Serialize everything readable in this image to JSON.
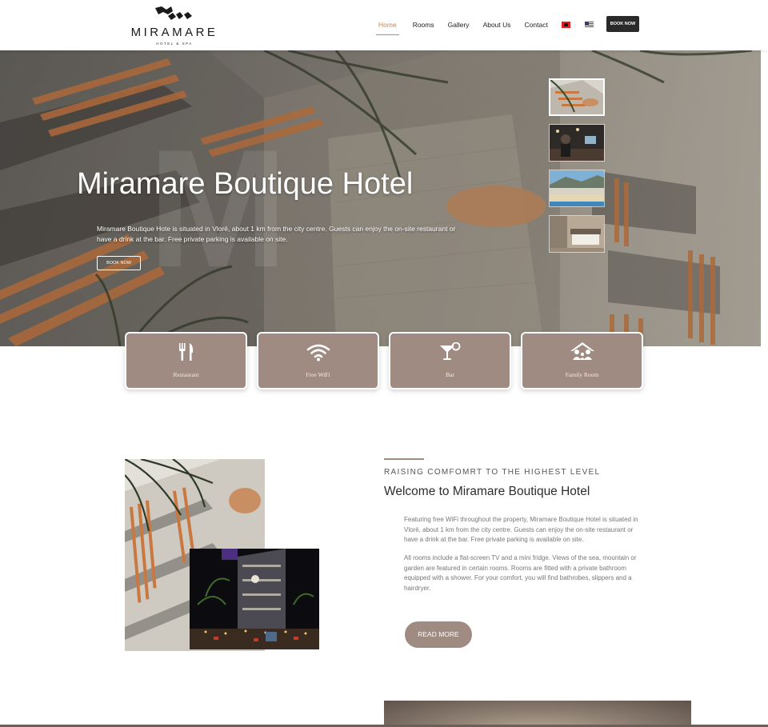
{
  "logo": {
    "name": "MIRAMARE",
    "tagline": "HOTEL & SPA"
  },
  "nav": {
    "items": [
      {
        "label": "Home",
        "active": true
      },
      {
        "label": "Rooms"
      },
      {
        "label": "Gallery"
      },
      {
        "label": "About Us"
      },
      {
        "label": "Contact"
      }
    ],
    "languages": [
      "albanian-flag-icon",
      "us-flag-icon"
    ],
    "book_label": "BOOK NOW"
  },
  "hero": {
    "title": "Miramare Boutique Hotel",
    "description": "Miramare Boutique Hote is situated in Vlorë, about 1 km from the city centre. Guests can enjoy the on-site restaurant or have a drink at the bar. Free private parking is available on site.",
    "button_label": "BOOK NOW",
    "thumbnails": [
      "facade-thumb",
      "reception-thumb",
      "beach-thumb",
      "room-thumb"
    ]
  },
  "features": [
    {
      "label": "Restaurant",
      "icon": "utensils-icon"
    },
    {
      "label": "Free WiFi",
      "icon": "wifi-icon"
    },
    {
      "label": "Bar",
      "icon": "cocktail-icon"
    },
    {
      "label": "Family Room",
      "icon": "family-icon"
    }
  ],
  "welcome": {
    "eyebrow": "RAISING COMFOMRT TO THE HIGHEST LEVEL",
    "title": "Welcome to Miramare Boutique Hotel",
    "paragraph1": "Featuring free WiFi throughout the property, Miramare Boutique Hotel is situated in Vlorë, about 1 km from the city centre. Guests can enjoy the on-site restaurant or have a drink at the bar. Free private parking is available on site.",
    "paragraph2": "All rooms include a flat-screen TV and a mini fridge. Views of the sea, mountain or garden are featured in certain rooms. Rooms are fitted with a private bathroom equipped with a shower. For your comfort, you will find bathrobes, slippers and a hairdryer.",
    "read_more_label": "READ MORE"
  },
  "colors": {
    "accent": "#c08a52",
    "card": "#9f8b82",
    "dark": "#2a2a2a"
  }
}
